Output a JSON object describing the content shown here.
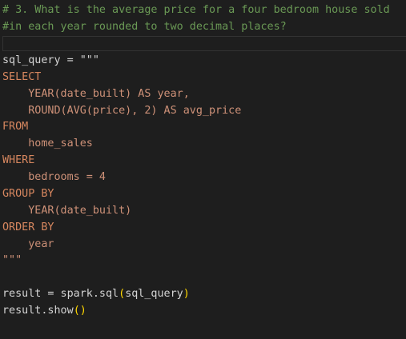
{
  "comment": {
    "line1": "# 3. What is the average price for a four bedroom house sold",
    "line2": "#in each year rounded to two decimal places?"
  },
  "code": {
    "assign": "sql_query = \"\"\"",
    "select": "SELECT",
    "col1": "    YEAR(date_built) AS year,",
    "col2": "    ROUND(AVG(price), 2) AS avg_price",
    "from": "FROM",
    "table": "    home_sales",
    "where": "WHERE",
    "condition": "    bedrooms = 4",
    "group_by": "GROUP BY",
    "group_col": "    YEAR(date_built)",
    "order_by": "ORDER BY",
    "order_col": "    year",
    "close_quote": "\"\"\"",
    "result_lhs": "result = spark.sql",
    "result_open": "(",
    "result_arg": "sql_query",
    "result_close": ")",
    "show_call": "result.show",
    "show_parens": "()"
  }
}
